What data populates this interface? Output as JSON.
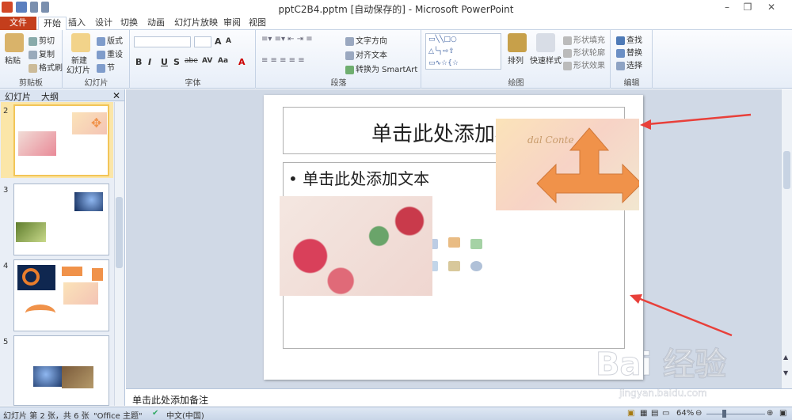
{
  "window": {
    "title": "pptC2B4.pptm [自动保存的] - Microsoft PowerPoint",
    "controls": [
      "minimize",
      "restore",
      "close"
    ]
  },
  "tabs": [
    "文件",
    "开始",
    "插入",
    "设计",
    "切换",
    "动画",
    "幻灯片放映",
    "审阅",
    "视图"
  ],
  "ribbon": {
    "clipboard": {
      "paste": "粘贴",
      "cut": "剪切",
      "copy": "复制",
      "format_painter": "格式刷",
      "label": "剪贴板"
    },
    "slides": {
      "new_slide": "新建",
      "new_slide2": "幻灯片",
      "layout": "版式",
      "reset": "重设",
      "section": "节",
      "label": "幻灯片"
    },
    "font": {
      "label": "字体",
      "bold": "B",
      "italic": "I",
      "underline": "U",
      "shadow": "S",
      "strike": "abe",
      "spacing": "AV",
      "case": "Aa",
      "grow": "A",
      "shrink": "A"
    },
    "paragraph": {
      "text_direction": "文字方向",
      "align_text": "对齐文本",
      "smartart": "转换为 SmartArt",
      "label": "段落"
    },
    "drawing": {
      "arrange": "排列",
      "quick_styles": "快速样式",
      "shape_fill": "形状填充",
      "shape_outline": "形状轮廓",
      "shape_effects": "形状效果",
      "label": "绘图"
    },
    "editing": {
      "find": "查找",
      "replace": "替换",
      "select": "选择",
      "label": "编辑"
    }
  },
  "pane": {
    "tab_slides": "幻灯片",
    "tab_outline": "大纲",
    "slide_numbers": [
      "2",
      "3",
      "4",
      "5"
    ]
  },
  "slide": {
    "title_placeholder": "单击此处添加标题",
    "body_placeholder": "单击此处添加文本",
    "banner_script": "dal Conte"
  },
  "notes_placeholder": "单击此处添加备注",
  "status": {
    "slide_info": "幻灯片 第 2 张，共 6 张",
    "theme": "\"Office 主题\"",
    "language": "中文(中国)",
    "zoom": "64%"
  },
  "watermark": {
    "logo": "Bai 经验",
    "url": "jingyan.baidu.com"
  },
  "colors": {
    "file_tab": "#c43e1c",
    "arrow_shape": "#f0924a",
    "annotation": "#e8403a",
    "selected_thumb": "#f2c558"
  }
}
